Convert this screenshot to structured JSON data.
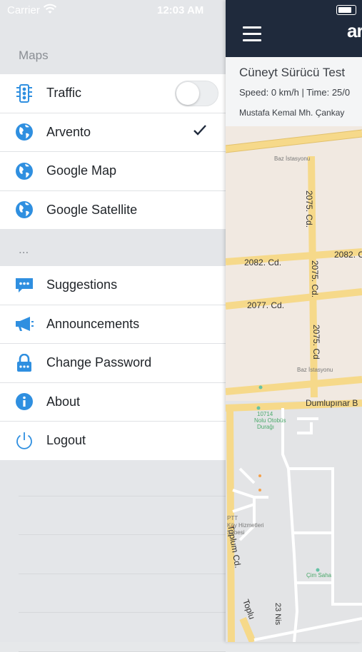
{
  "status_bar": {
    "carrier": "Carrier",
    "time": "12:03 AM"
  },
  "drawer": {
    "maps_header": "Maps",
    "map_items": [
      {
        "label": "Traffic",
        "icon": "traffic-light-icon",
        "toggle_on": false
      },
      {
        "label": "Arvento",
        "icon": "globe-icon",
        "selected": true
      },
      {
        "label": "Google Map",
        "icon": "globe-icon"
      },
      {
        "label": "Google Satellite",
        "icon": "globe-icon"
      }
    ],
    "more_header": "...",
    "menu_items": [
      {
        "label": "Suggestions",
        "icon": "chat-bubble-icon"
      },
      {
        "label": "Announcements",
        "icon": "megaphone-icon"
      },
      {
        "label": "Change Password",
        "icon": "lock-icon"
      },
      {
        "label": "About",
        "icon": "info-icon"
      },
      {
        "label": "Logout",
        "icon": "power-icon"
      }
    ],
    "accent_color": "#2f8fe0"
  },
  "app": {
    "brand": "ar",
    "vehicle": {
      "name": "Cüneyt Sürücü Test",
      "speed_line": "Speed: 0 km/h | Time: 25/0",
      "address": "Mustafa Kemal Mh.  Çankay"
    },
    "navbar_color": "#1f2a3c",
    "map_labels": {
      "road_a": "2075. Cd.",
      "road_b": "2082. Cd.",
      "road_b2": "2082. C",
      "road_c": "2077. Cd.",
      "road_d": "2075. Cd.",
      "road_e": "2075. Cd",
      "road_dumlupinar": "Dumlupınar B",
      "road_toplum": "Toplum Cd.",
      "road_toplu": "Toplu",
      "road_23nis": "23 Nis",
      "poi_baz1": "Baz İstasyonu",
      "poi_baz2": "Baz İstasyonu",
      "poi_durak_1": "10714",
      "poi_durak_2": "Nolu Otobüs",
      "poi_durak_3": "Durağı",
      "poi_ptt_1": "PTT",
      "poi_ptt_2": "Köy Hizmetleri",
      "poi_ptt_3": "Şubesi",
      "poi_cim": "Çim Saha"
    }
  }
}
